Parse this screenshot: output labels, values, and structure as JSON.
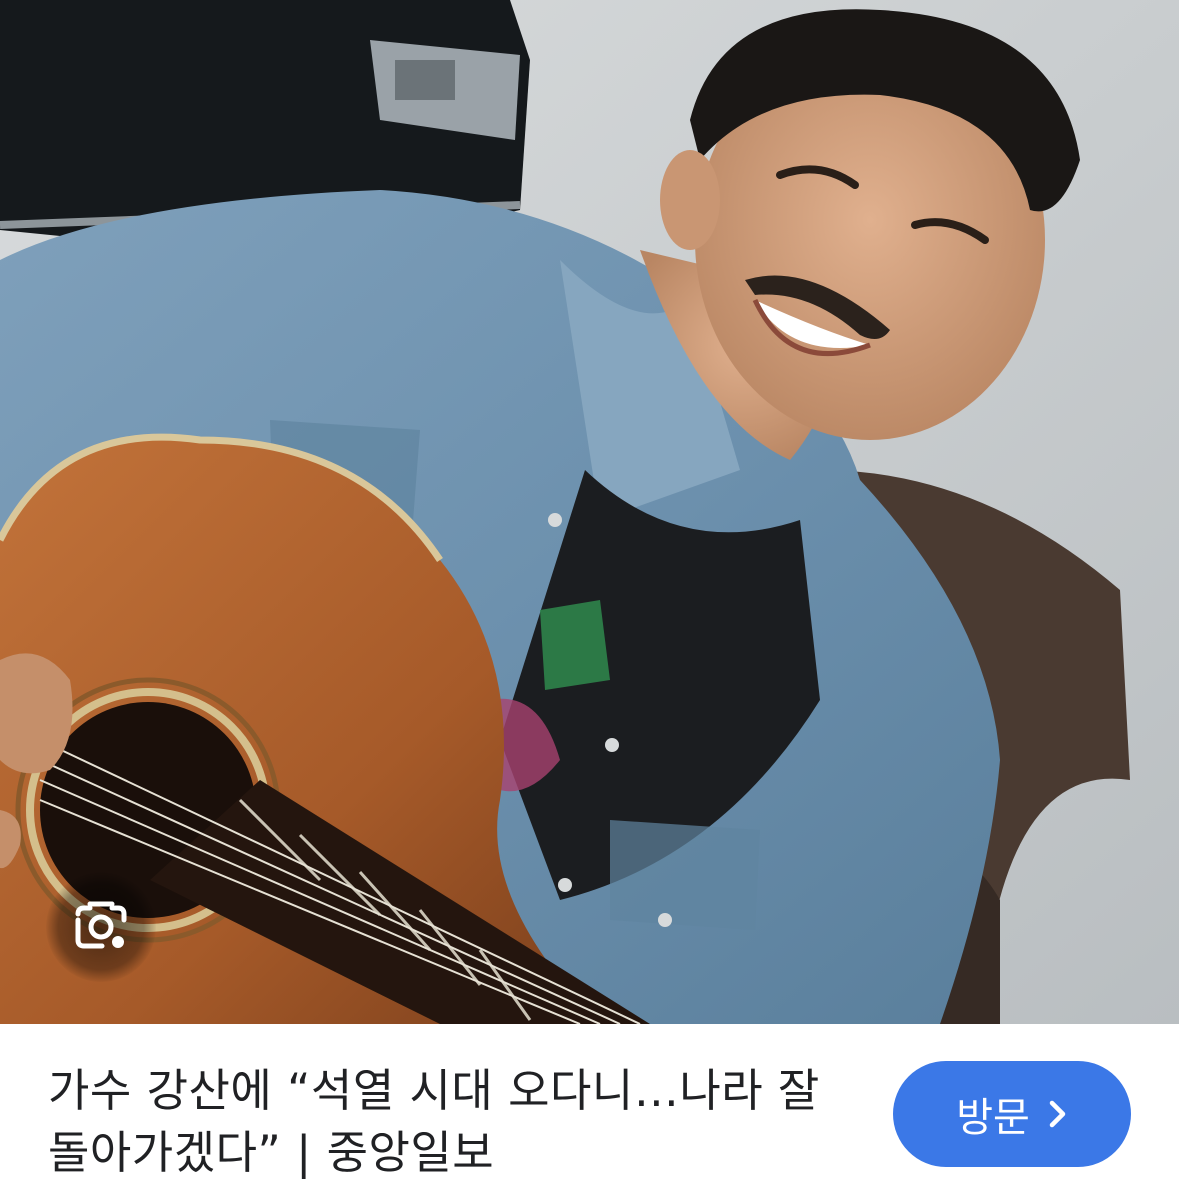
{
  "result": {
    "image_alt": "가수 강산에",
    "title": "가수 강산에 “석열 시대 오다니…나라 잘 돌아가겠다” | 중앙일보",
    "visit_button": {
      "label": "방문",
      "icon": "chevron-right-icon"
    },
    "lens_button": {
      "icon": "google-lens-icon"
    }
  },
  "colors": {
    "button_blue": "#3b78e7",
    "title_text": "#202124",
    "background": "#ffffff"
  }
}
